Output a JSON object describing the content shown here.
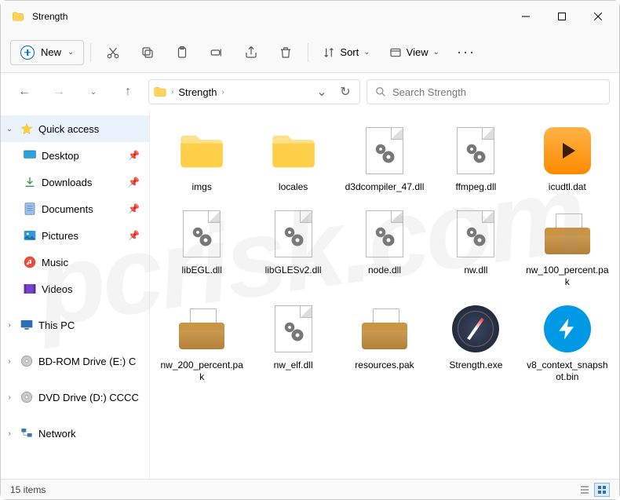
{
  "window": {
    "title": "Strength"
  },
  "toolbar": {
    "new_label": "New",
    "sort_label": "Sort",
    "view_label": "View"
  },
  "nav": {
    "crumb1": "Strength",
    "search_placeholder": "Search Strength"
  },
  "sidebar": {
    "quick_access": "Quick access",
    "desktop": "Desktop",
    "downloads": "Downloads",
    "documents": "Documents",
    "pictures": "Pictures",
    "music": "Music",
    "videos": "Videos",
    "this_pc": "This PC",
    "bd": "BD-ROM Drive (E:) C",
    "dvd": "DVD Drive (D:) CCCC",
    "network": "Network"
  },
  "files": {
    "f0": "imgs",
    "f1": "locales",
    "f2": "d3dcompiler_47.dll",
    "f3": "ffmpeg.dll",
    "f4": "icudtl.dat",
    "f5": "libEGL.dll",
    "f6": "libGLESv2.dll",
    "f7": "node.dll",
    "f8": "nw.dll",
    "f9": "nw_100_percent.pak",
    "f10": "nw_200_percent.pak",
    "f11": "nw_elf.dll",
    "f12": "resources.pak",
    "f13": "Strength.exe",
    "f14": "v8_context_snapshot.bin"
  },
  "status": {
    "count": "15 items"
  }
}
